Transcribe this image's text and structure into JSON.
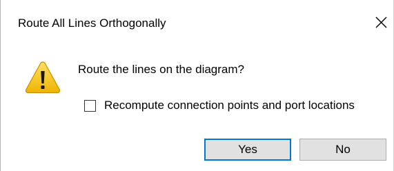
{
  "window": {
    "title": "Route All Lines Orthogonally"
  },
  "dialog": {
    "icon": "warning-icon",
    "message": "Route the lines on the diagram?",
    "checkbox": {
      "label": "Recompute connection points and port locations",
      "checked": false
    },
    "buttons": {
      "yes_label": "Yes",
      "no_label": "No"
    }
  },
  "colors": {
    "default_button_border": "#0078d7",
    "button_background": "#e1e1e1",
    "warning_yellow": "#f5c211",
    "background": "#ffffff"
  }
}
